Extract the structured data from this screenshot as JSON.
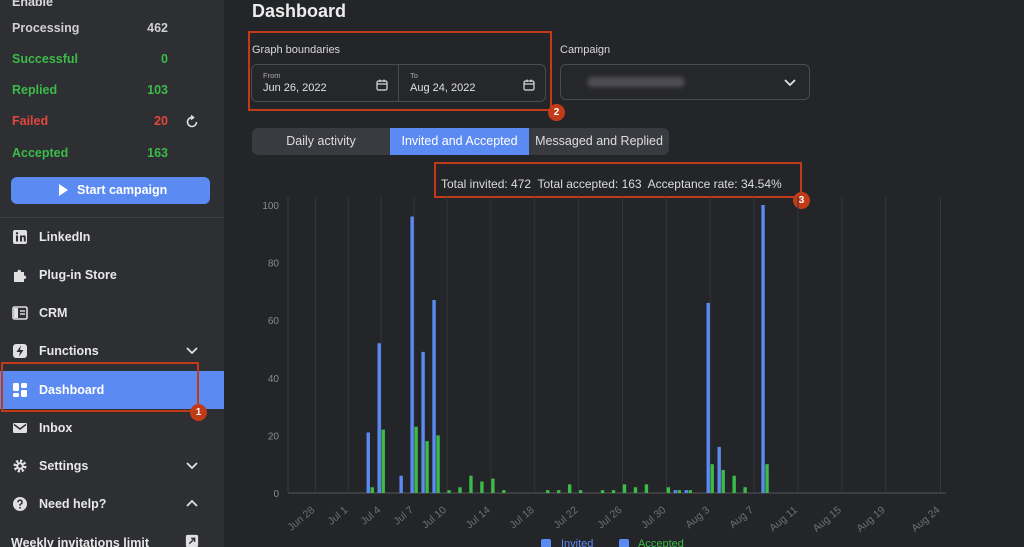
{
  "sidebar": {
    "top_stat": {
      "label": "Enable",
      "value": ""
    },
    "stats": [
      {
        "label": "Processing",
        "value": "462",
        "color": "#cfcfcf"
      },
      {
        "label": "Successful",
        "value": "0",
        "color": "#3cba4a"
      },
      {
        "label": "Replied",
        "value": "103",
        "color": "#3cba4a"
      },
      {
        "label": "Failed",
        "value": "20",
        "color": "#e3463c"
      },
      {
        "label": "Accepted",
        "value": "163",
        "color": "#3cba4a"
      }
    ],
    "start_campaign_label": "Start campaign",
    "nav": [
      {
        "label": "LinkedIn",
        "icon": "linkedin-icon"
      },
      {
        "label": "Plug-in Store",
        "icon": "puzzle-icon"
      },
      {
        "label": "CRM",
        "icon": "crm-icon"
      },
      {
        "label": "Functions",
        "icon": "bolt-icon",
        "chevron": "down"
      },
      {
        "label": "Dashboard",
        "icon": "dashboard-icon",
        "active": true
      },
      {
        "label": "Inbox",
        "icon": "mail-icon"
      },
      {
        "label": "Settings",
        "icon": "gear-icon",
        "chevron": "down"
      },
      {
        "label": "Need help?",
        "icon": "help-icon",
        "chevron": "up"
      },
      {
        "label": "Weekly invitations limit",
        "icon": "external-link-icon"
      }
    ]
  },
  "main": {
    "title": "Dashboard",
    "graph_boundaries_label": "Graph boundaries",
    "from": {
      "label": "From",
      "value": "Jun 26, 2022"
    },
    "to": {
      "label": "To",
      "value": "Aug 24, 2022"
    },
    "campaign_label": "Campaign",
    "tabs": [
      "Daily activity",
      "Invited and Accepted",
      "Messaged and Replied"
    ],
    "active_tab": "Invited and Accepted",
    "totals_text": "Total invited: 472  Total accepted: 163  Acceptance rate: 34.54%"
  },
  "annotations": [
    "1",
    "2",
    "3"
  ],
  "colors": {
    "accent": "#5b8af2",
    "invited": "#5b8af2",
    "accepted": "#3cba4a",
    "highlight": "#c23b19"
  },
  "chart_data": {
    "type": "bar",
    "x_ticks": [
      "Jun 28",
      "Jul 1",
      "Jul 4",
      "Jul 7",
      "Jul 10",
      "Jul 14",
      "Jul 18",
      "Jul 22",
      "Jul 26",
      "Jul 30",
      "Aug 3",
      "Aug 7",
      "Aug 11",
      "Aug 15",
      "Aug 19",
      "Aug 24"
    ],
    "y_ticks": [
      0,
      20,
      40,
      60,
      80,
      100
    ],
    "ylim": [
      0,
      100
    ],
    "x_start": "Jun 26",
    "categories": [
      "Jun 26",
      "Jun 27",
      "Jun 28",
      "Jun 29",
      "Jun 30",
      "Jul 1",
      "Jul 2",
      "Jul 3",
      "Jul 4",
      "Jul 5",
      "Jul 6",
      "Jul 7",
      "Jul 8",
      "Jul 9",
      "Jul 10",
      "Jul 11",
      "Jul 12",
      "Jul 13",
      "Jul 14",
      "Jul 15",
      "Jul 16",
      "Jul 17",
      "Jul 18",
      "Jul 19",
      "Jul 20",
      "Jul 21",
      "Jul 22",
      "Jul 23",
      "Jul 24",
      "Jul 25",
      "Jul 26",
      "Jul 27",
      "Jul 28",
      "Jul 29",
      "Jul 30",
      "Jul 31",
      "Aug 1",
      "Aug 2",
      "Aug 3",
      "Aug 4",
      "Aug 5",
      "Aug 6",
      "Aug 7",
      "Aug 8",
      "Aug 9",
      "Aug 10",
      "Aug 11",
      "Aug 12",
      "Aug 13",
      "Aug 14",
      "Aug 15",
      "Aug 16",
      "Aug 17",
      "Aug 18",
      "Aug 19",
      "Aug 20",
      "Aug 21",
      "Aug 22",
      "Aug 23",
      "Aug 24"
    ],
    "series": [
      {
        "name": "Invited",
        "color": "#5b8af2",
        "values": [
          0,
          0,
          0,
          0,
          0,
          0,
          0,
          21,
          52,
          0,
          6,
          96,
          49,
          67,
          0,
          0,
          0,
          0,
          0,
          0,
          0,
          0,
          0,
          0,
          0,
          0,
          0,
          0,
          0,
          0,
          0,
          0,
          0,
          0,
          0,
          1,
          1,
          0,
          66,
          16,
          0,
          0,
          0,
          100,
          0,
          0,
          0,
          0,
          0,
          0,
          0,
          0,
          0,
          0,
          0,
          0,
          0,
          0,
          0,
          0
        ]
      },
      {
        "name": "Accepted",
        "color": "#3cba4a",
        "values": [
          0,
          0,
          0,
          0,
          0,
          0,
          0,
          2,
          22,
          0,
          0,
          23,
          18,
          20,
          1,
          2,
          6,
          4,
          5,
          1,
          0,
          0,
          0,
          1,
          1,
          3,
          1,
          0,
          1,
          1,
          3,
          2,
          3,
          0,
          2,
          1,
          1,
          0,
          10,
          8,
          6,
          2,
          0,
          10,
          0,
          0,
          0,
          0,
          0,
          0,
          0,
          0,
          0,
          0,
          0,
          0,
          0,
          0,
          0,
          0
        ]
      }
    ],
    "legend": [
      "Invited",
      "Accepted"
    ],
    "legend_position": "bottom",
    "grid": true
  }
}
